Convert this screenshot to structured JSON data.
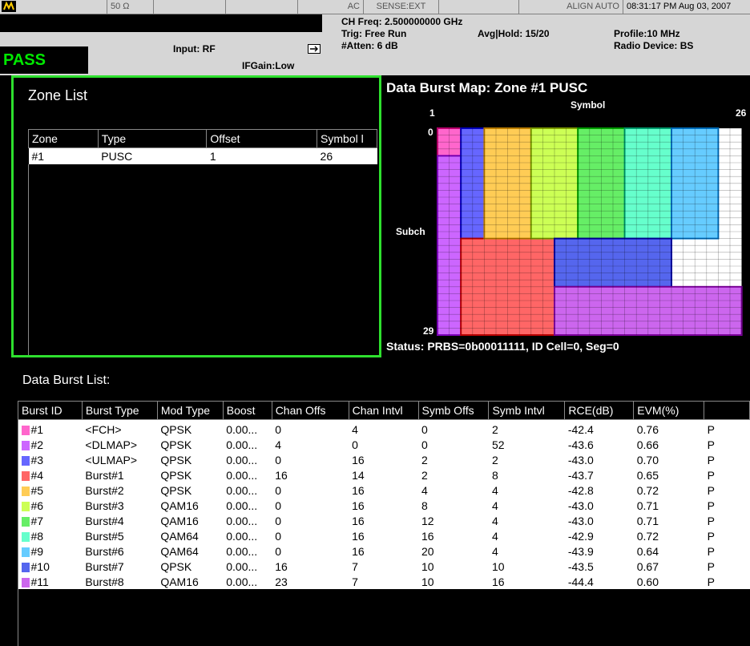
{
  "status_bar": {
    "segments": [
      "50 Ω",
      "",
      "",
      "AC",
      "SENSE:EXT",
      "",
      "ALIGN AUTO",
      "08:31:17 PM Aug 03, 2007"
    ],
    "pass": "PASS",
    "input": "Input: RF",
    "ifgain": "IFGain:Low",
    "ch_freq": "CH Freq: 2.500000000 GHz",
    "trig": "Trig: Free Run",
    "atten": "#Atten: 6 dB",
    "avg_hold": "Avg|Hold: 15/20",
    "profile": "Profile:10 MHz",
    "radio_device": "Radio Device: BS"
  },
  "zone_list": {
    "title": "Zone List",
    "headers": [
      "Zone",
      "Type",
      "Offset",
      "Symbol l"
    ],
    "rows": [
      [
        "#1",
        "PUSC",
        "1",
        "26"
      ]
    ]
  },
  "burst_map": {
    "title": "Data Burst Map: Zone #1 PUSC",
    "symbol_label": "Symbol",
    "subch_label": "Subch",
    "sym_start": "1",
    "sym_end": "26",
    "subch_start": "0",
    "subch_end": "29",
    "status": "Status: PRBS=0b00011111, ID Cell=0, Seg=0"
  },
  "burst_list": {
    "title": "Data Burst List:",
    "headers": [
      "Burst ID",
      "Burst Type",
      "Mod Type",
      "Boost",
      "Chan Offs",
      "Chan Intvl",
      "Symb Offs",
      "Symb Intvl",
      "RCE(dB)",
      "EVM(%)",
      ""
    ],
    "rows": [
      {
        "id": "#1",
        "type": "<FCH>",
        "mod": "QPSK",
        "boost": "0.00...",
        "coff": "0",
        "cint": "4",
        "soff": "0",
        "sint": "2",
        "rce": "-42.4",
        "evm": "0.76",
        "res": "P",
        "color": "#ff66cc"
      },
      {
        "id": "#2",
        "type": "<DLMAP>",
        "mod": "QPSK",
        "boost": "0.00...",
        "coff": "4",
        "cint": "0",
        "soff": "0",
        "sint": "52",
        "rce": "-43.6",
        "evm": "0.66",
        "res": "P",
        "color": "#cc66ff"
      },
      {
        "id": "#3",
        "type": "<ULMAP>",
        "mod": "QPSK",
        "boost": "0.00...",
        "coff": "0",
        "cint": "16",
        "soff": "2",
        "sint": "2",
        "rce": "-43.0",
        "evm": "0.70",
        "res": "P",
        "color": "#6666ff"
      },
      {
        "id": "#4",
        "type": "Burst#1",
        "mod": "QPSK",
        "boost": "0.00...",
        "coff": "16",
        "cint": "14",
        "soff": "2",
        "sint": "8",
        "rce": "-43.7",
        "evm": "0.65",
        "res": "P",
        "color": "#ff6666"
      },
      {
        "id": "#5",
        "type": "Burst#2",
        "mod": "QPSK",
        "boost": "0.00...",
        "coff": "0",
        "cint": "16",
        "soff": "4",
        "sint": "4",
        "rce": "-42.8",
        "evm": "0.72",
        "res": "P",
        "color": "#ffcc55"
      },
      {
        "id": "#6",
        "type": "Burst#3",
        "mod": "QAM16",
        "boost": "0.00...",
        "coff": "0",
        "cint": "16",
        "soff": "8",
        "sint": "4",
        "rce": "-43.0",
        "evm": "0.71",
        "res": "P",
        "color": "#ccff55"
      },
      {
        "id": "#7",
        "type": "Burst#4",
        "mod": "QAM16",
        "boost": "0.00...",
        "coff": "0",
        "cint": "16",
        "soff": "12",
        "sint": "4",
        "rce": "-43.0",
        "evm": "0.71",
        "res": "P",
        "color": "#66ee66"
      },
      {
        "id": "#8",
        "type": "Burst#5",
        "mod": "QAM64",
        "boost": "0.00...",
        "coff": "0",
        "cint": "16",
        "soff": "16",
        "sint": "4",
        "rce": "-42.9",
        "evm": "0.72",
        "res": "P",
        "color": "#66ffcc"
      },
      {
        "id": "#9",
        "type": "Burst#6",
        "mod": "QAM64",
        "boost": "0.00...",
        "coff": "0",
        "cint": "16",
        "soff": "20",
        "sint": "4",
        "rce": "-43.9",
        "evm": "0.64",
        "res": "P",
        "color": "#66ccff"
      },
      {
        "id": "#10",
        "type": "Burst#7",
        "mod": "QPSK",
        "boost": "0.00...",
        "coff": "16",
        "cint": "7",
        "soff": "10",
        "sint": "10",
        "rce": "-43.5",
        "evm": "0.67",
        "res": "P",
        "color": "#5566ee"
      },
      {
        "id": "#11",
        "type": "Burst#8",
        "mod": "QAM16",
        "boost": "0.00...",
        "coff": "23",
        "cint": "7",
        "soff": "10",
        "sint": "16",
        "rce": "-44.4",
        "evm": "0.60",
        "res": "P",
        "color": "#cc66ee"
      }
    ]
  }
}
